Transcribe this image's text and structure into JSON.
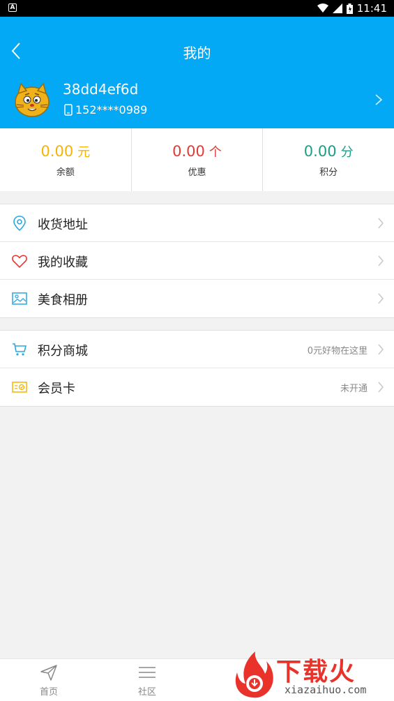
{
  "status_bar": {
    "time": "11:41",
    "left_icon": "A"
  },
  "header": {
    "title": "我的",
    "bg_color": "#03a9f4"
  },
  "profile": {
    "username": "38dd4ef6d",
    "phone": "152****0989"
  },
  "stats": [
    {
      "value": "0.00",
      "unit": "元",
      "label": "余额",
      "color": "#f5b400"
    },
    {
      "value": "0.00",
      "unit": "个",
      "label": "优惠",
      "color": "#e53935"
    },
    {
      "value": "0.00",
      "unit": "分",
      "label": "积分",
      "color": "#1a9f86"
    }
  ],
  "menu_group1": [
    {
      "label": "收货地址",
      "icon": "location-pin-icon"
    },
    {
      "label": "我的收藏",
      "icon": "heart-icon"
    },
    {
      "label": "美食相册",
      "icon": "photo-icon"
    }
  ],
  "menu_group2": [
    {
      "label": "积分商城",
      "note": "0元好物在这里",
      "icon": "cart-icon"
    },
    {
      "label": "会员卡",
      "note": "未开通",
      "icon": "member-card-icon"
    }
  ],
  "tabbar": [
    {
      "label": "首页",
      "icon": "paper-plane-icon"
    },
    {
      "label": "社区",
      "icon": "menu-lines-icon"
    }
  ],
  "watermark": {
    "brand": "下载火",
    "domain": "xiazaihuo.com"
  }
}
